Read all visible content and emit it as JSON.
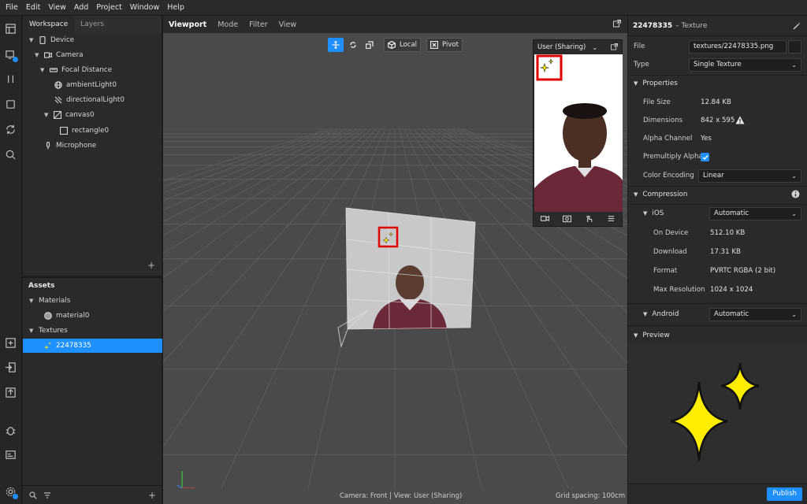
{
  "menu": [
    "File",
    "Edit",
    "View",
    "Add",
    "Project",
    "Window",
    "Help"
  ],
  "scene": {
    "tabs": [
      "Workspace",
      "Layers"
    ],
    "tree": [
      {
        "label": "Device",
        "level": 0,
        "expanded": true,
        "icon": "device-icon"
      },
      {
        "label": "Camera",
        "level": 1,
        "expanded": true,
        "icon": "camera-icon"
      },
      {
        "label": "Focal Distance",
        "level": 2,
        "expanded": true,
        "icon": "focal-distance-icon"
      },
      {
        "label": "ambientLight0",
        "level": 3,
        "icon": "ambient-light-icon"
      },
      {
        "label": "directionalLight0",
        "level": 3,
        "icon": "directional-light-icon"
      },
      {
        "label": "canvas0",
        "level": 2,
        "expanded": true,
        "icon": "canvas-icon"
      },
      {
        "label": "rectangle0",
        "level": 3,
        "icon": "rectangle-icon"
      },
      {
        "label": "Microphone",
        "level": 1,
        "icon": "microphone-icon"
      }
    ]
  },
  "assets": {
    "title": "Assets",
    "materials_label": "Materials",
    "material_item": "material0",
    "textures_label": "Textures",
    "texture_item": "22478335"
  },
  "viewport": {
    "tabs": [
      "Viewport",
      "Mode",
      "Filter",
      "View"
    ],
    "local_label": "Local",
    "pivot_label": "Pivot",
    "status_left": "Camera: Front | View: User (Sharing)",
    "status_right": "Grid spacing: 100cm",
    "sharing_title": "User (Sharing)"
  },
  "inspector": {
    "title": "22478335",
    "subtitle": "– Texture",
    "file_label": "File",
    "file_value": "textures/22478335.png",
    "type_label": "Type",
    "type_value": "Single Texture",
    "properties_label": "Properties",
    "file_size_label": "File Size",
    "file_size_value": "12.84 KB",
    "dimensions_label": "Dimensions",
    "dimensions_value": "842 x 595",
    "alpha_label": "Alpha Channel",
    "alpha_value": "Yes",
    "premult_label": "Premultiply Alpha",
    "premult_checked": true,
    "color_enc_label": "Color Encoding",
    "color_enc_value": "Linear",
    "compression_label": "Compression",
    "ios_label": "iOS",
    "ios_value": "Automatic",
    "on_device_label": "On Device",
    "on_device_value": "512.10 KB",
    "download_label": "Download",
    "download_value": "17.31 KB",
    "format_label": "Format",
    "format_value": "PVRTC RGBA (2 bit)",
    "max_res_label": "Max Resolution",
    "max_res_value": "1024 x 1024",
    "android_label": "Android",
    "android_value": "Automatic",
    "preview_label": "Preview",
    "publish_label": "Publish"
  },
  "colors": {
    "accent": "#1e90ff",
    "highlight_box": "#e00000",
    "sparkle": "#ffee00"
  }
}
